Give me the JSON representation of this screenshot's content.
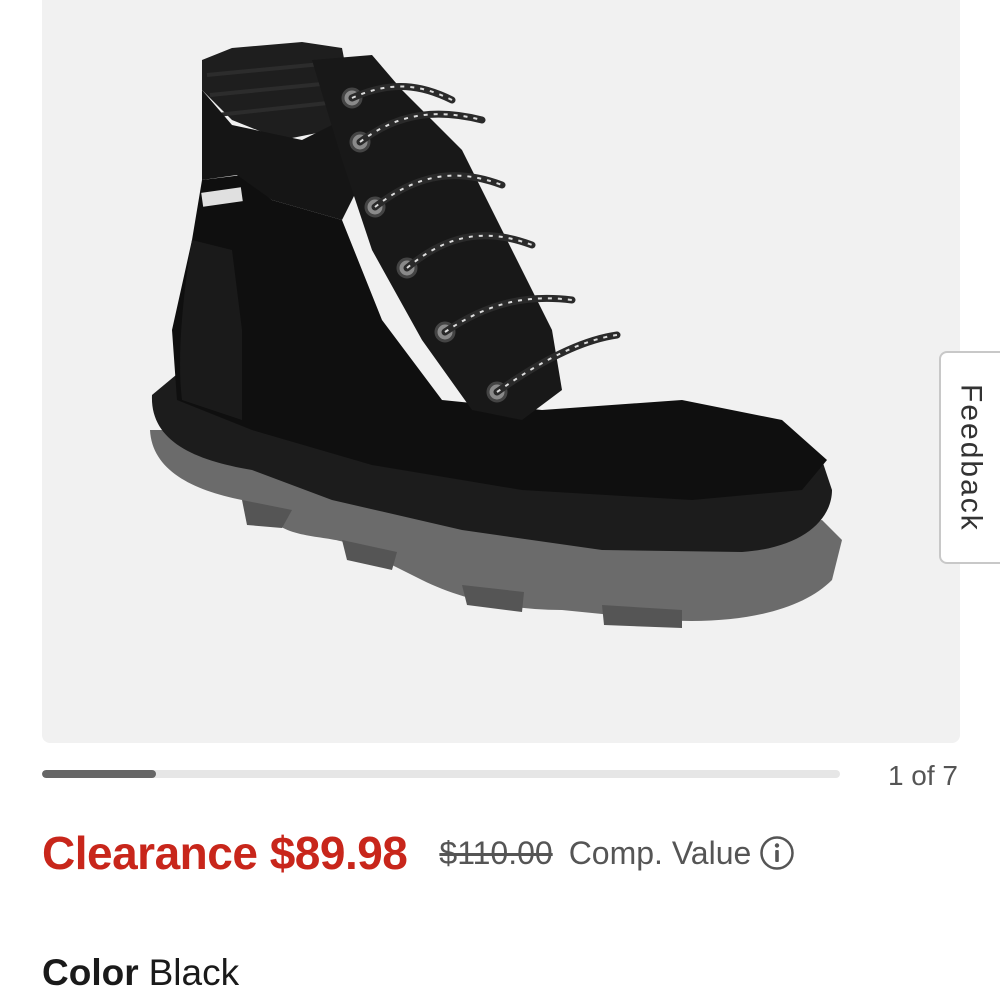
{
  "gallery": {
    "current": 1,
    "total": 7,
    "counter_text": "1 of 7",
    "progress_fraction": 0.143,
    "image_alt": "black-suede-lace-up-boot"
  },
  "feedback": {
    "label": "Feedback"
  },
  "pricing": {
    "sale_label": "Clearance $89.98",
    "original_price": "$110.00",
    "comp_value_label": "Comp. Value",
    "info_icon": "info-icon"
  },
  "color": {
    "label": "Color",
    "value": "Black"
  },
  "colors": {
    "sale": "#c8261b",
    "progress_fill": "#666666",
    "progress_track": "#e6e6e6",
    "image_bg": "#f1f1f1"
  }
}
